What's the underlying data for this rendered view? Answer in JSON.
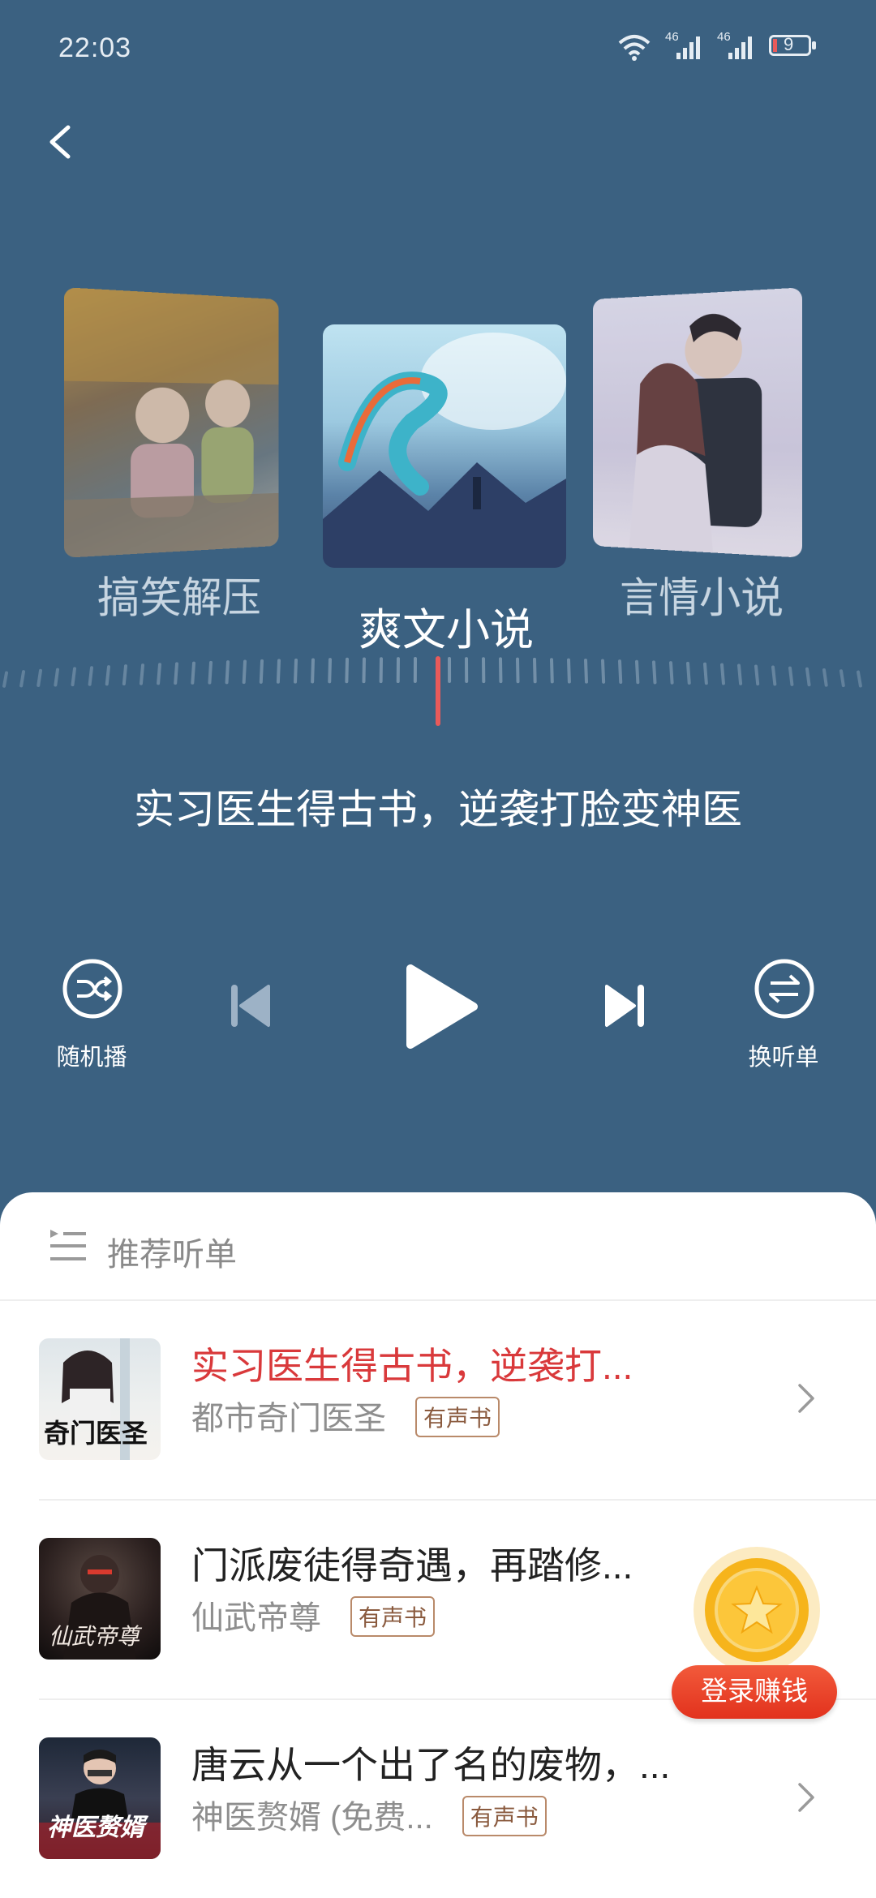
{
  "status_bar": {
    "time": "22:03",
    "battery": "9",
    "net1": "46",
    "net2": "46"
  },
  "categories": [
    {
      "label": "搞笑解压"
    },
    {
      "label": "爽文小说"
    },
    {
      "label": "言情小说"
    }
  ],
  "now_playing": {
    "title": "实习医生得古书，逆袭打脸变神医"
  },
  "controls": {
    "shuffle_label": "随机播",
    "switch_label": "换听单"
  },
  "playlist": {
    "header": "推荐听单",
    "items": [
      {
        "title": "实习医生得古书，逆袭打...",
        "book": "都市奇门医圣",
        "tag": "有声书",
        "active": true,
        "cover_text": "奇门医圣"
      },
      {
        "title": "门派废徒得奇遇，再踏修...",
        "book": "仙武帝尊",
        "tag": "有声书",
        "active": false,
        "cover_text": "仙武帝尊"
      },
      {
        "title": "唐云从一个出了名的废物，...",
        "book": "神医赘婿 (免费...",
        "tag": "有声书",
        "active": false,
        "cover_text": "神医赘婿"
      }
    ]
  },
  "promo": {
    "label": "登录赚钱"
  },
  "colors": {
    "background": "#3b6181",
    "accent": "#d9393b",
    "indicator": "#e85a5a"
  }
}
